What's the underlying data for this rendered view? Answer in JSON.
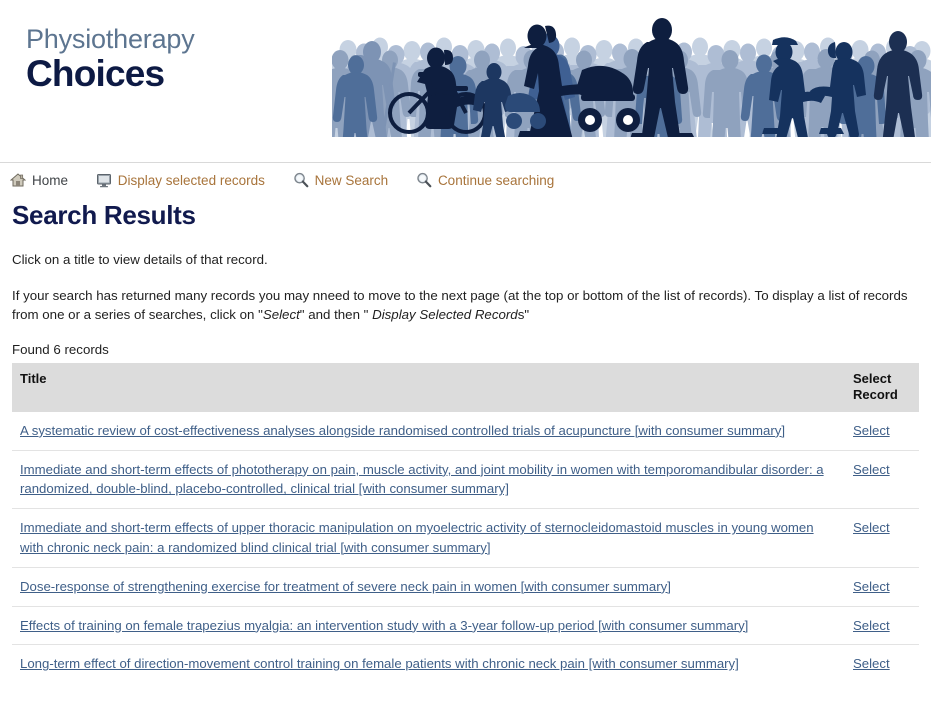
{
  "site": {
    "logo_line1": "Physiotherapy",
    "logo_line2": "Choices",
    "banner_alt": "crowd-of-people-silhouettes"
  },
  "nav": {
    "items": [
      {
        "label": "Home",
        "icon": "home-icon",
        "style": "home"
      },
      {
        "label": "Display selected records",
        "icon": "monitor-icon",
        "style": "link"
      },
      {
        "label": "New Search",
        "icon": "magnifier-icon",
        "style": "link"
      },
      {
        "label": "Continue searching",
        "icon": "magnifier-icon",
        "style": "link"
      }
    ]
  },
  "page": {
    "title": "Search Results",
    "intro_1": "Click on a title to view details of that record.",
    "intro_2_part1": "If your search has returned many records you may nneed to move to the next page (at the top or bottom of the list of records). To display a list of records from one or a series of searches, click on \"",
    "intro_2_em1": "Select",
    "intro_2_part2": "\" and then \" ",
    "intro_2_em2": "Display Selected Record",
    "intro_2_part3": "s\"",
    "found_text": "Found 6 records"
  },
  "table": {
    "header_title": "Title",
    "header_select_line1": "Select",
    "header_select_line2": "Record",
    "select_label": "Select",
    "rows": [
      {
        "title": "A systematic review of cost-effectiveness analyses alongside randomised controlled trials of acupuncture [with consumer summary]",
        "select": "Select"
      },
      {
        "title": "Immediate and short-term effects of phototherapy on pain, muscle activity, and joint mobility in women with temporomandibular disorder: a randomized, double-blind, placebo-controlled, clinical trial [with consumer summary]",
        "select": "Select"
      },
      {
        "title": "Immediate and short-term effects of upper thoracic manipulation on myoelectric activity of sternocleidomastoid muscles in young women with chronic neck pain: a randomized blind clinical trial [with consumer summary]",
        "select": "Select"
      },
      {
        "title": "Dose-response of strengthening exercise for treatment of severe neck pain in women [with consumer summary]",
        "select": "Select"
      },
      {
        "title": "Effects of training on female trapezius myalgia: an intervention study with a 3-year follow-up period [with consumer summary]",
        "select": "Select"
      },
      {
        "title": "Long-term effect of direction-movement control training on female patients with chronic neck pain [with consumer summary]",
        "select": "Select"
      }
    ]
  },
  "colors": {
    "logo_top": "#5d7590",
    "logo_bottom": "#0d1a44",
    "heading": "#111a4e",
    "nav_link": "#a8743b",
    "nav_home": "#404448",
    "record_link": "#3f5f88",
    "table_header_bg": "#dcdcdc"
  }
}
